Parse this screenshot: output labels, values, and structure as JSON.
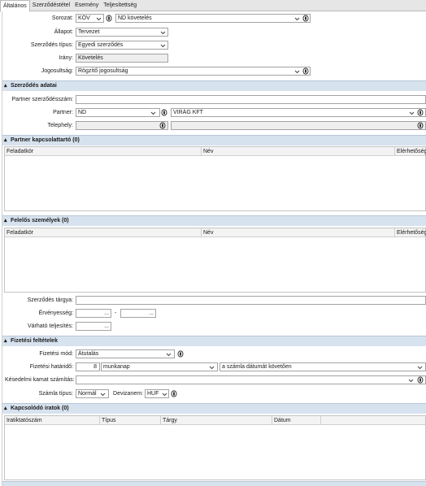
{
  "tabs": [
    "Általános",
    "Szerződéstétel",
    "Esemény",
    "Teljesítettség"
  ],
  "general": {
    "sorozat": {
      "label": "Sorozat:",
      "code": "KÖV",
      "name": "ND követelés"
    },
    "allapot": {
      "label": "Állapot:",
      "value": "Tervezet"
    },
    "tipus": {
      "label": "Szerződés típus:",
      "value": "Egyedi szerződés"
    },
    "irany": {
      "label": "Irány:",
      "value": "Követelés"
    },
    "jogosultsag": {
      "label": "Jogosultság:",
      "value": "Rögzítő jogosultság"
    }
  },
  "contract_data": {
    "title": "Szerződés adatai",
    "partner_contract_no": {
      "label": "Partner szerződésszám:",
      "value": ""
    },
    "partner": {
      "label": "Partner:",
      "code": "ND",
      "name": "VIRÁG KFT"
    },
    "site": {
      "label": "Telephely:",
      "value": ""
    }
  },
  "partner_contacts": {
    "title": "Partner kapcsolattartó (0)",
    "columns": [
      "Feladatkör",
      "Név",
      "Elérhetőség"
    ]
  },
  "responsible": {
    "title": "Felelős személyek (0)",
    "columns": [
      "Feladatkör",
      "Név",
      "Elérhetőség"
    ]
  },
  "subject": {
    "label": "Szerződés tárgya:",
    "value": ""
  },
  "validity": {
    "label": "Érvényesség:",
    "from": "...",
    "separator": "-",
    "to": "..."
  },
  "expected": {
    "label": "Várható teljesítés:",
    "value": "..."
  },
  "payment": {
    "title": "Fizetési feltételek",
    "method": {
      "label": "Fizetési mód:",
      "value": "Átutalás"
    },
    "deadline": {
      "label": "Fizetési határidő:",
      "days": "8",
      "unit": "munkanap",
      "basis": "a számla dátumát követően"
    },
    "late_interest": {
      "label": "Késedelmi kamat számítás:",
      "value": ""
    },
    "invoice_type": {
      "label": "Számla típus:",
      "value": "Normál"
    },
    "currency": {
      "label": "Devizanem:",
      "value": "HUF"
    }
  },
  "related_docs": {
    "title": "Kapcsolódó iratok (0)",
    "columns": [
      "Iratiktatószám",
      "Típus",
      "Tárgy",
      "Dátum"
    ]
  }
}
